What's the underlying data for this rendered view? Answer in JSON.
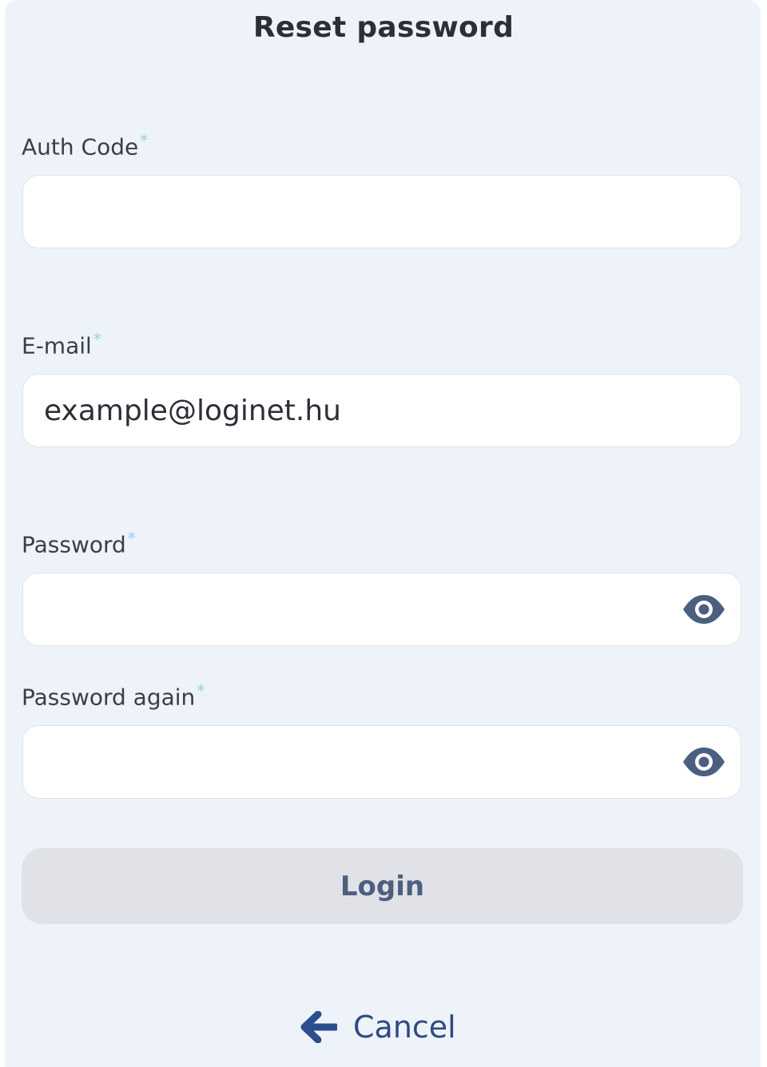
{
  "header": {
    "title": "Reset password"
  },
  "form": {
    "auth_code": {
      "label": "Auth Code",
      "required_mark": "*",
      "value": ""
    },
    "email": {
      "label": "E-mail",
      "required_mark": "*",
      "value": "example@loginet.hu"
    },
    "password": {
      "label": "Password",
      "required_mark": "*",
      "value": "",
      "toggle_icon": "eye-icon"
    },
    "password_again": {
      "label": "Password again",
      "required_mark": "*",
      "value": "",
      "toggle_icon": "eye-icon"
    }
  },
  "actions": {
    "login_label": "Login",
    "cancel_label": "Cancel",
    "cancel_icon": "arrow-left-icon"
  },
  "colors": {
    "panel_background": "#eef3fa",
    "required_mark": "#8fd0ef",
    "icon": "#4c5f80",
    "button_disabled_background": "#e0e2e7",
    "link": "#2f4a80"
  }
}
